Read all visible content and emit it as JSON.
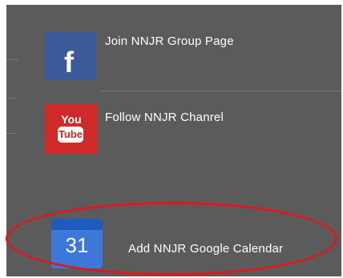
{
  "links": [
    {
      "label": "Join NNJR Group Page",
      "icon": "facebook-icon",
      "glyph": "f"
    },
    {
      "label": "Follow NNJR Chanrel",
      "icon": "youtube-icon",
      "glyph_top": "You",
      "glyph_bottom": "Tube"
    },
    {
      "label": "Add NNJR Google Calendar",
      "icon": "google-calendar-icon",
      "glyph": "31"
    }
  ],
  "colors": {
    "panel": "#5b5b5b",
    "facebook": "#3c5a99",
    "youtube": "#cf2a2a",
    "calendar": "#3c78d8",
    "highlight": "#e3161b"
  }
}
